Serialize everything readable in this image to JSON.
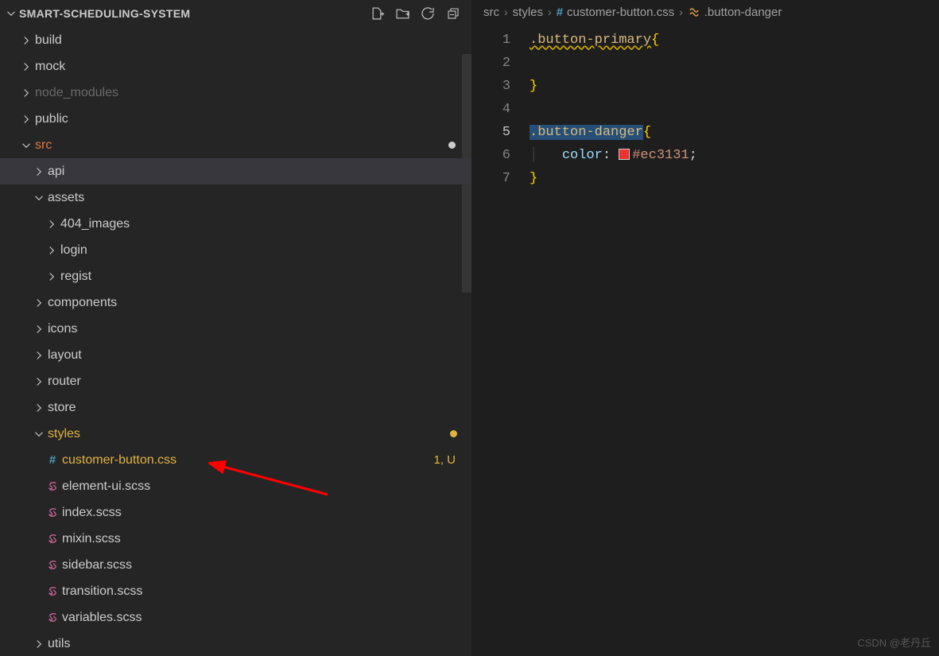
{
  "explorer": {
    "title": "SMART-SCHEDULING-SYSTEM",
    "items": [
      {
        "type": "folder",
        "expanded": false,
        "depth": 0,
        "label": "build",
        "state": ""
      },
      {
        "type": "folder",
        "expanded": false,
        "depth": 0,
        "label": "mock",
        "state": ""
      },
      {
        "type": "folder",
        "expanded": false,
        "depth": 0,
        "label": "node_modules",
        "state": "dim"
      },
      {
        "type": "folder",
        "expanded": false,
        "depth": 0,
        "label": "public",
        "state": ""
      },
      {
        "type": "folder",
        "expanded": true,
        "depth": 0,
        "label": "src",
        "state": "orange",
        "dot": "unsaved"
      },
      {
        "type": "folder",
        "expanded": false,
        "depth": 1,
        "label": "api",
        "state": "",
        "selected": true
      },
      {
        "type": "folder",
        "expanded": true,
        "depth": 1,
        "label": "assets",
        "state": ""
      },
      {
        "type": "folder",
        "expanded": false,
        "depth": 2,
        "label": "404_images",
        "state": ""
      },
      {
        "type": "folder",
        "expanded": false,
        "depth": 2,
        "label": "login",
        "state": ""
      },
      {
        "type": "folder",
        "expanded": false,
        "depth": 2,
        "label": "regist",
        "state": ""
      },
      {
        "type": "folder",
        "expanded": false,
        "depth": 1,
        "label": "components",
        "state": ""
      },
      {
        "type": "folder",
        "expanded": false,
        "depth": 1,
        "label": "icons",
        "state": ""
      },
      {
        "type": "folder",
        "expanded": false,
        "depth": 1,
        "label": "layout",
        "state": ""
      },
      {
        "type": "folder",
        "expanded": false,
        "depth": 1,
        "label": "router",
        "state": ""
      },
      {
        "type": "folder",
        "expanded": false,
        "depth": 1,
        "label": "store",
        "state": ""
      },
      {
        "type": "folder",
        "expanded": true,
        "depth": 1,
        "label": "styles",
        "state": "mod",
        "dot": "modified"
      },
      {
        "type": "file",
        "icon": "hash",
        "depth": 2,
        "label": "customer-button.css",
        "state": "mod",
        "decoration": "1, U"
      },
      {
        "type": "file",
        "icon": "sass",
        "depth": 2,
        "label": "element-ui.scss",
        "state": ""
      },
      {
        "type": "file",
        "icon": "sass",
        "depth": 2,
        "label": "index.scss",
        "state": ""
      },
      {
        "type": "file",
        "icon": "sass",
        "depth": 2,
        "label": "mixin.scss",
        "state": ""
      },
      {
        "type": "file",
        "icon": "sass",
        "depth": 2,
        "label": "sidebar.scss",
        "state": ""
      },
      {
        "type": "file",
        "icon": "sass",
        "depth": 2,
        "label": "transition.scss",
        "state": ""
      },
      {
        "type": "file",
        "icon": "sass",
        "depth": 2,
        "label": "variables.scss",
        "state": ""
      },
      {
        "type": "folder",
        "expanded": false,
        "depth": 1,
        "label": "utils",
        "state": ""
      }
    ]
  },
  "breadcrumb": {
    "parts": [
      "src",
      "styles",
      "customer-button.css",
      ".button-danger"
    ],
    "icons": [
      "",
      "",
      "hash",
      "selector"
    ]
  },
  "editor": {
    "lines": [
      {
        "n": 1,
        "tokens": [
          [
            "selector-sq",
            ".button-primary"
          ],
          [
            "brace",
            "{"
          ]
        ]
      },
      {
        "n": 2,
        "tokens": []
      },
      {
        "n": 3,
        "tokens": [
          [
            "brace",
            "}"
          ]
        ]
      },
      {
        "n": 4,
        "tokens": []
      },
      {
        "n": 5,
        "current": true,
        "tokens": [
          [
            "selector-sel",
            ".button-danger"
          ],
          [
            "brace",
            "{"
          ]
        ]
      },
      {
        "n": 6,
        "tokens": [
          [
            "guide",
            "│   "
          ],
          [
            "prop",
            "color"
          ],
          [
            "punct",
            ": "
          ],
          [
            "swatch",
            ""
          ],
          [
            "color",
            "#ec3131"
          ],
          [
            "punct",
            ";"
          ]
        ]
      },
      {
        "n": 7,
        "tokens": [
          [
            "brace",
            "}"
          ]
        ]
      }
    ]
  },
  "watermark": "CSDN @老丹丘"
}
